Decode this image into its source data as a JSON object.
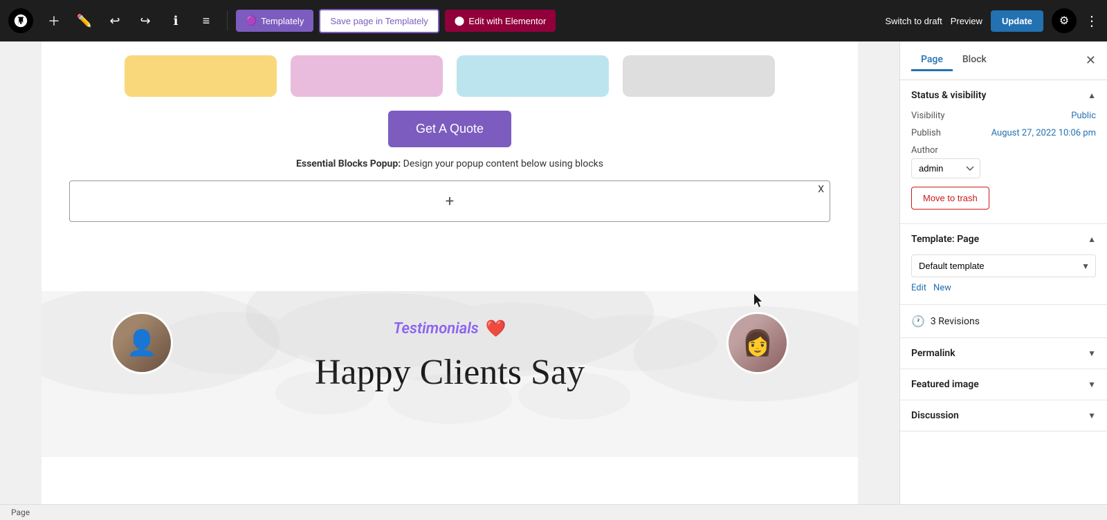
{
  "toolbar": {
    "templately_label": "Templately",
    "save_templately_label": "Save page in Templately",
    "elementor_label": "Edit with Elementor",
    "switch_draft_label": "Switch to draft",
    "preview_label": "Preview",
    "update_label": "Update"
  },
  "canvas": {
    "get_quote_label": "Get A Quote",
    "popup_notice_bold": "Essential Blocks Popup:",
    "popup_notice_text": " Design your popup content below using blocks",
    "testimonials_label": "Testimonials",
    "happy_clients_label": "Happy Clients Say"
  },
  "sidebar": {
    "page_tab": "Page",
    "block_tab": "Block",
    "status_section_title": "Status & visibility",
    "visibility_label": "Visibility",
    "visibility_value": "Public",
    "publish_label": "Publish",
    "publish_value": "August 27, 2022 10:06 pm",
    "author_label": "Author",
    "author_value": "admin",
    "move_trash_label": "Move to trash",
    "template_section_title": "Template: Page",
    "template_default": "Default template",
    "template_edit_label": "Edit",
    "template_new_label": "New",
    "revisions_label": "3 Revisions",
    "permalink_label": "Permalink",
    "featured_image_label": "Featured image",
    "discussion_label": "Discussion"
  },
  "statusbar": {
    "text": "Page"
  }
}
